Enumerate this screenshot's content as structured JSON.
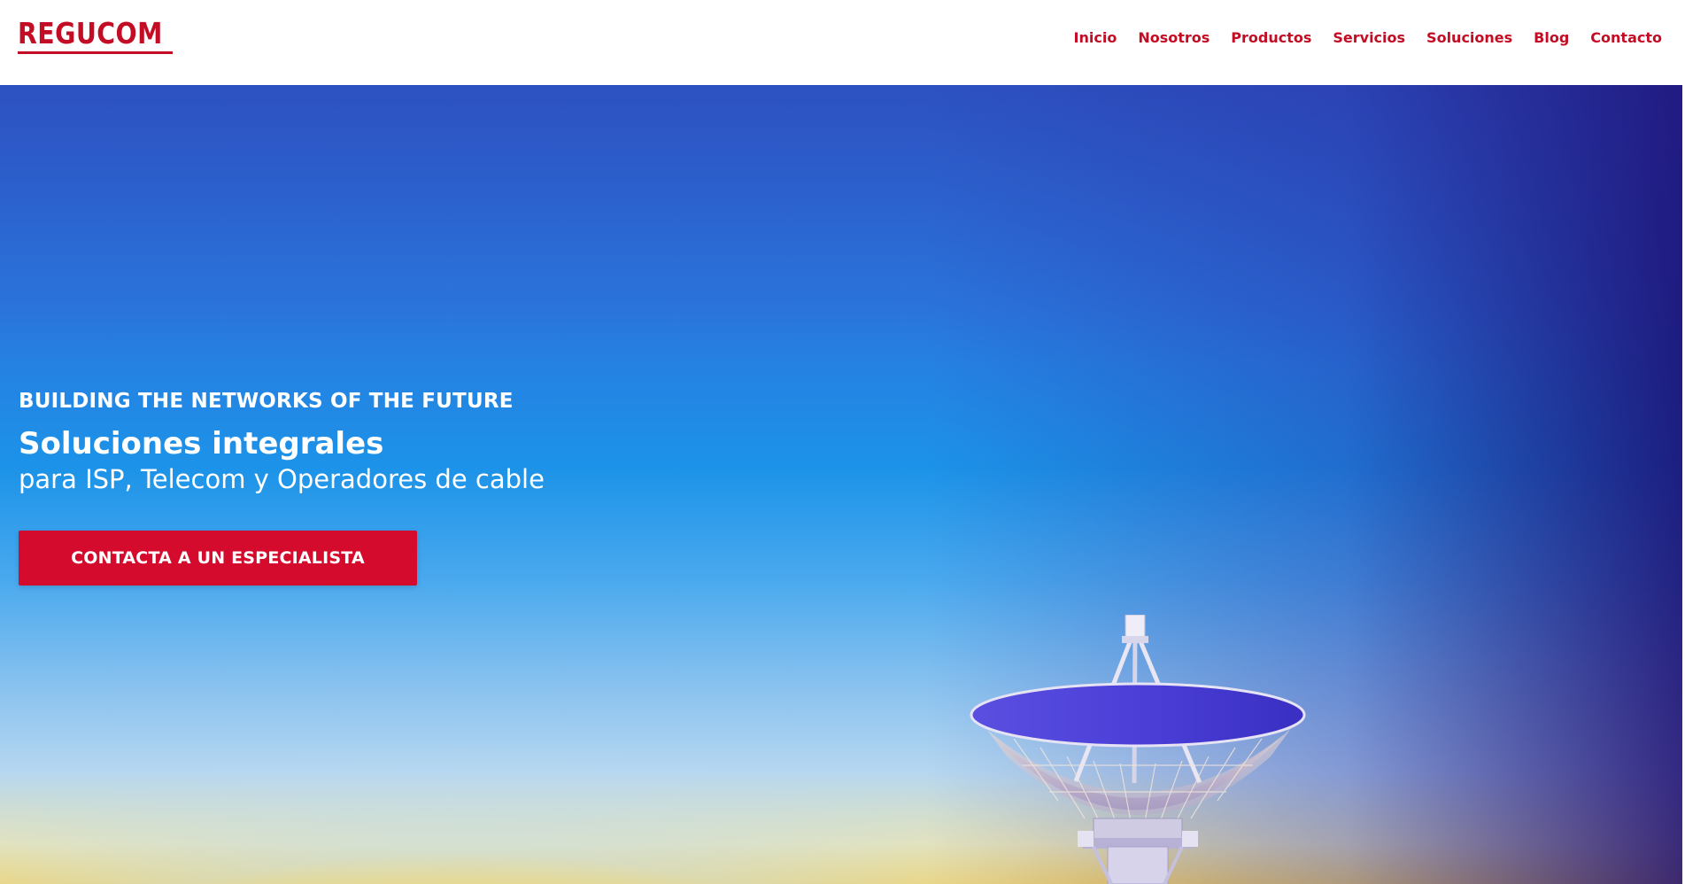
{
  "brand": {
    "logo_text": "REGUCOM",
    "primary_color": "#c30d25"
  },
  "nav": {
    "items": [
      {
        "label": "Inicio"
      },
      {
        "label": "Nosotros"
      },
      {
        "label": "Productos"
      },
      {
        "label": "Servicios"
      },
      {
        "label": "Soluciones"
      },
      {
        "label": "Blog"
      },
      {
        "label": "Contacto"
      }
    ]
  },
  "hero": {
    "kicker": "BUILDING THE NETWORKS OF THE FUTURE",
    "title": "Soluciones integrales",
    "subtitle": "para ISP, Telecom y Operadores de cable",
    "cta_label": "CONTACTA A UN ESPECIALISTA",
    "cta_color": "#d50b2d",
    "background_image": "satellite-dish-antenna",
    "sky_colors": [
      "#2f5fcf",
      "#1c93e8",
      "#8cc3ef",
      "#f6d66a"
    ]
  }
}
